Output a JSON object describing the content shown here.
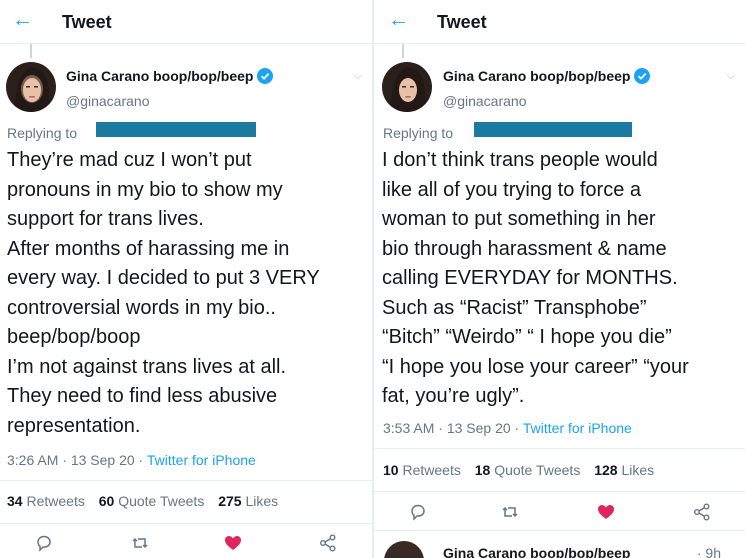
{
  "colors": {
    "accent": "#1da1f2",
    "like": "#e0245e",
    "secondary": "#657786",
    "redaction": "#1b7aa0"
  },
  "left": {
    "header": {
      "back_icon": "back-arrow-icon",
      "title": "Tweet"
    },
    "author": {
      "name": "Gina Carano boop/bop/beep",
      "handle": "@ginacarano"
    },
    "replying_to": "Replying to",
    "text_lines": [
      "They’re mad cuz I won’t put",
      "pronouns in my bio to show my",
      "support for trans lives.",
      "After months of harassing me in",
      "every way. I decided to put 3 VERY",
      "controversial words in my bio..",
      "beep/bop/boop",
      "I’m not against trans lives at all.",
      "They need to find less abusive",
      "representation."
    ],
    "meta": {
      "time": "3:26 AM",
      "date": "13 Sep 20",
      "source": "Twitter for iPhone"
    },
    "stats": {
      "retweets_count": "34",
      "retweets_label": "Retweets",
      "quotes_count": "60",
      "quotes_label": "Quote Tweets",
      "likes_count": "275",
      "likes_label": "Likes"
    }
  },
  "right": {
    "header": {
      "back_icon": "back-arrow-icon",
      "title": "Tweet"
    },
    "author": {
      "name": "Gina Carano boop/bop/beep",
      "handle": "@ginacarano"
    },
    "replying_to": "Replying to",
    "text_lines": [
      "I don’t think trans people would",
      "like all of you trying to force a",
      "woman to put something in her",
      "bio through harassment & name",
      "calling EVERYDAY for MONTHS.",
      "Such as “Racist” Transphobe”",
      "“Bitch” “Weirdo” “ I hope you die”",
      "“I hope you lose your career” “your",
      "fat, you’re ugly”."
    ],
    "meta": {
      "time": "3:53 AM",
      "date": "13 Sep 20",
      "source": "Twitter for iPhone"
    },
    "stats": {
      "retweets_count": "10",
      "retweets_label": "Retweets",
      "quotes_count": "18",
      "quotes_label": "Quote Tweets",
      "likes_count": "128",
      "likes_label": "Likes"
    },
    "next_tweet": {
      "name": "Gina Carano boop/bop/beep",
      "time": "· 9h"
    }
  }
}
